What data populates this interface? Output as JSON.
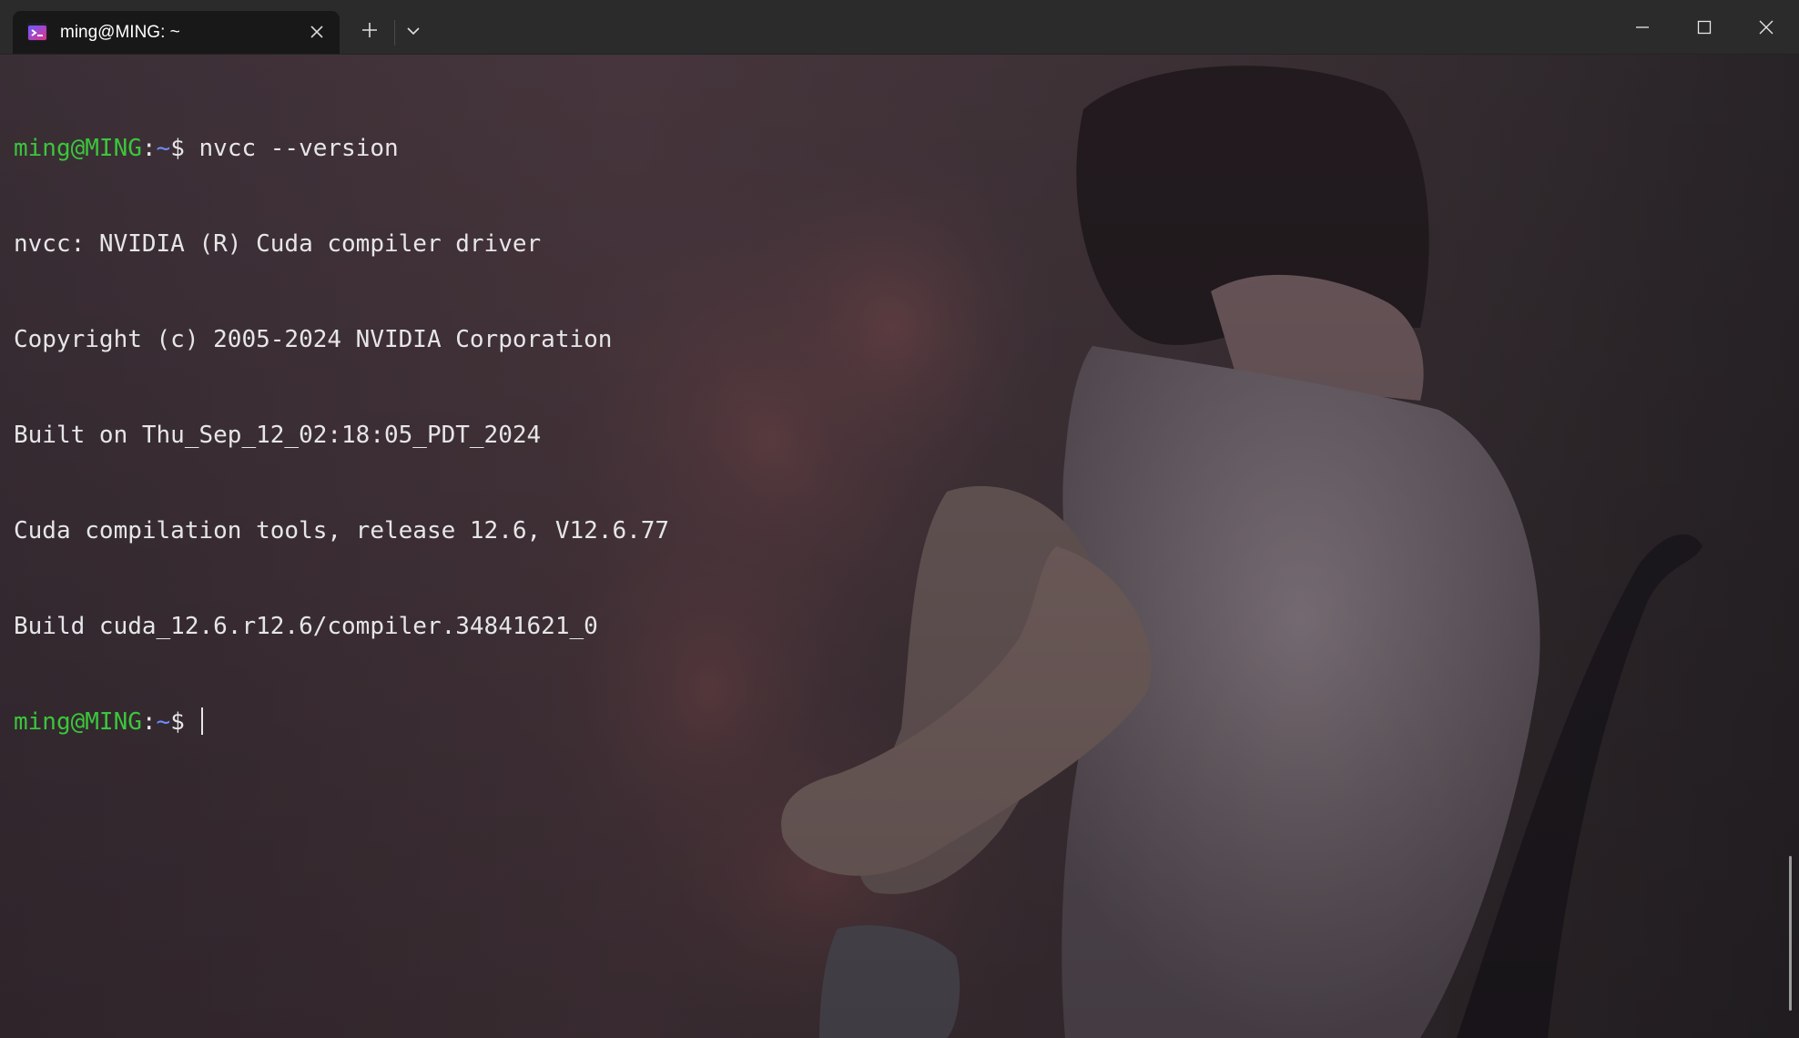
{
  "tab": {
    "title": "ming@MING: ~",
    "icon": "terminal-app-icon"
  },
  "toolbar": {
    "new_tab_icon": "plus-icon",
    "dropdown_icon": "chevron-down-icon"
  },
  "window_controls": {
    "minimize_icon": "minimize-icon",
    "maximize_icon": "maximize-icon",
    "close_icon": "close-icon"
  },
  "terminal": {
    "prompt": {
      "user_host": "ming@MING",
      "separator": ":",
      "path": "~",
      "symbol": "$"
    },
    "command": " nvcc --version",
    "output": [
      "nvcc: NVIDIA (R) Cuda compiler driver",
      "Copyright (c) 2005-2024 NVIDIA Corporation",
      "Built on Thu_Sep_12_02:18:05_PDT_2024",
      "Cuda compilation tools, release 12.6, V12.6.77",
      "Build cuda_12.6.r12.6/compiler.34841621_0"
    ],
    "colors": {
      "prompt_user": "#3bc63b",
      "prompt_path": "#6b8cff",
      "text": "#e6e6e6"
    }
  }
}
